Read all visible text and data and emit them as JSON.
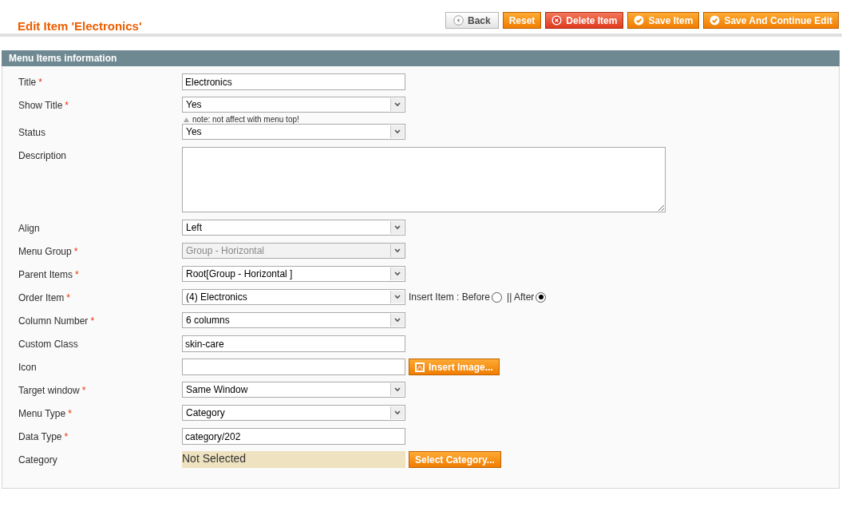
{
  "header": {
    "title": "Edit Item 'Electronics'",
    "buttons": [
      {
        "kind": "back",
        "label": "Back"
      },
      {
        "kind": "plain",
        "label": "Reset"
      },
      {
        "kind": "delete",
        "label": "Delete Item"
      },
      {
        "kind": "save",
        "label": "Save Item"
      },
      {
        "kind": "save",
        "label": "Save And Continue Edit"
      }
    ]
  },
  "section": {
    "title": "Menu Items information"
  },
  "fields": [
    {
      "kind": "text",
      "label": "Title",
      "required_mark": "*",
      "value": "Electronics"
    },
    {
      "kind": "select",
      "label": "Show Title",
      "required_mark": "*",
      "value": "Yes",
      "note": "note: not affect with menu top!"
    },
    {
      "kind": "select",
      "label": "Status",
      "value": "Yes"
    },
    {
      "kind": "textarea",
      "label": "Description"
    },
    {
      "kind": "select",
      "label": "Align",
      "value": "Left"
    },
    {
      "kind": "select",
      "label": "Menu Group",
      "required_mark": "*",
      "value": "Group - Horizontal",
      "disabled": true
    },
    {
      "kind": "select",
      "label": "Parent Items",
      "required_mark": "*",
      "value": "Root[Group - Horizontal ]"
    },
    {
      "kind": "select",
      "label": "Order Item",
      "required_mark": "*",
      "value": "(4) Electronics",
      "insert_options": [
        {
          "label": "Insert Item : Before",
          "selected": false
        },
        {
          "label": "|| After",
          "selected": true
        }
      ]
    },
    {
      "kind": "select",
      "label": "Column Number",
      "required_mark": "*",
      "value": "6 columns"
    },
    {
      "kind": "text",
      "label": "Custom Class",
      "value": "skin-care"
    },
    {
      "kind": "image",
      "label": "Icon",
      "button": "Insert Image..."
    },
    {
      "kind": "select",
      "label": "Target window",
      "required_mark": "*",
      "value": "Same Window"
    },
    {
      "kind": "select",
      "label": "Menu Type",
      "required_mark": "*",
      "value": "Category"
    },
    {
      "kind": "text",
      "label": "Data Type",
      "required_mark": "*",
      "value": "category/202"
    },
    {
      "kind": "category",
      "label": "Category",
      "value": "Not Selected",
      "button": "Select Category..."
    }
  ]
}
